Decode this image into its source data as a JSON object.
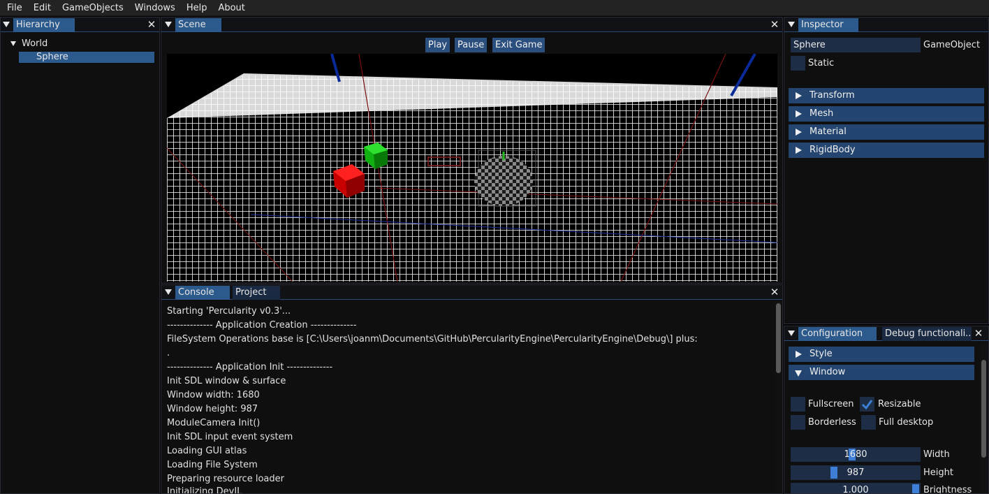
{
  "menubar": {
    "items": [
      "File",
      "Edit",
      "GameObjects",
      "Windows",
      "Help",
      "About"
    ]
  },
  "hierarchy": {
    "tab_label": "Hierarchy",
    "tree": [
      {
        "label": "World",
        "expanded": true
      },
      {
        "label": "Sphere",
        "selected": true
      }
    ]
  },
  "scene": {
    "tab_label": "Scene",
    "buttons": {
      "play": "Play",
      "pause": "Pause",
      "exit": "Exit Game"
    }
  },
  "bottom": {
    "tabs": [
      "Console",
      "Project"
    ],
    "active_tab": "Console",
    "console_lines": [
      "Starting 'Percularity v0.3'...",
      "-------------- Application Creation --------------",
      "FileSystem Operations base is [C:\\Users\\joanm\\Documents\\GitHub\\PercularityEngine\\PercularityEngine\\Debug\\] plus:",
      ".",
      "-------------- Application Init --------------",
      "Init SDL window & surface",
      "Window width: 1680",
      "Window height: 987",
      "ModuleCamera Init()",
      "Init SDL input event system",
      "Loading GUI atlas",
      "Loading File System",
      "Preparing resource loader",
      "Initializing DevIL"
    ]
  },
  "inspector": {
    "tab_label": "Inspector",
    "object_name": "Sphere",
    "object_type_label": "GameObject",
    "static_label": "Static",
    "static_checked": false,
    "components": [
      "Transform",
      "Mesh",
      "Material",
      "RigidBody"
    ]
  },
  "configuration": {
    "tabs": [
      "Configuration",
      "Debug functionali..."
    ],
    "active_tab": "Configuration",
    "sections": {
      "style": "Style",
      "window": "Window"
    },
    "checkboxes": {
      "fullscreen": {
        "label": "Fullscreen",
        "checked": false
      },
      "resizable": {
        "label": "Resizable",
        "checked": true
      },
      "borderless": {
        "label": "Borderless",
        "checked": false
      },
      "full_desktop": {
        "label": "Full desktop",
        "checked": false
      }
    },
    "sliders": {
      "width": {
        "label": "Width",
        "value": "1680"
      },
      "height": {
        "label": "Height",
        "value": "987"
      },
      "brightness": {
        "label": "Brightness",
        "value": "1.000"
      }
    }
  },
  "colors": {
    "accent": "#2d5a8c",
    "check": "#3d7fd6"
  }
}
